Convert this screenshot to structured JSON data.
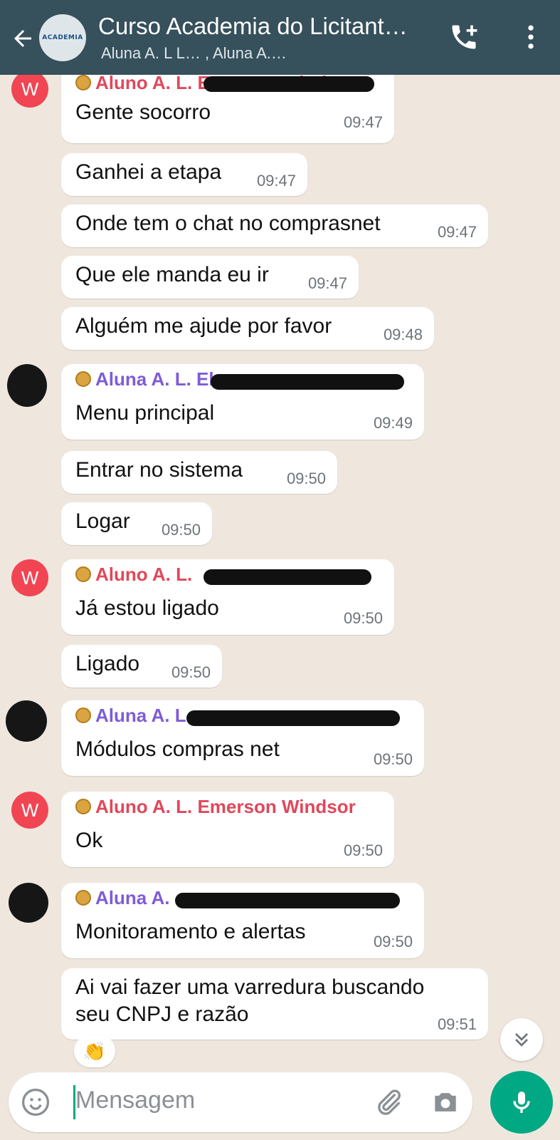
{
  "header": {
    "title": "Curso Academia do Licitant…",
    "subtitle": "Aluna A. L L… , Aluna A.…",
    "avatar_text": "ACADEMIA"
  },
  "messages": [
    {
      "sender": "Aluno A. L. Emerson Windsor",
      "text": "Gente socorro",
      "time": "09:47"
    },
    {
      "text": "Ganhei a etapa",
      "time": "09:47"
    },
    {
      "text": "Onde tem o chat no comprasnet",
      "time": "09:47"
    },
    {
      "text": "Que ele manda eu ir",
      "time": "09:47"
    },
    {
      "text": "Alguém me ajude por favor",
      "time": "09:48"
    },
    {
      "sender": "Aluna A. L. El",
      "text": "Menu principal",
      "time": "09:49"
    },
    {
      "text": "Entrar no sistema",
      "time": "09:50"
    },
    {
      "text": "Logar",
      "time": "09:50"
    },
    {
      "sender": "Aluno A. L.",
      "text": "Já estou ligado",
      "time": "09:50"
    },
    {
      "text": "Ligado",
      "time": "09:50"
    },
    {
      "sender": "Aluna A. L.",
      "text": "Módulos compras net",
      "time": "09:50"
    },
    {
      "sender": "Aluno A. L. Emerson Windsor",
      "text": "Ok",
      "time": "09:50"
    },
    {
      "sender": "Aluna A.",
      "text": "Monitoramento e alertas",
      "time": "09:50"
    },
    {
      "text_line1": "Ai vai fazer uma varredura buscando",
      "text_line2": "seu CNPJ e razão",
      "time": "09:51"
    }
  ],
  "avatar_letter": "W",
  "reaction": "👏",
  "input": {
    "placeholder": "Mensagem"
  },
  "colors": {
    "header_bg": "#36505c",
    "male_sender": "#e0485a",
    "female_sender": "#7e5cd6",
    "accent": "#00a884"
  },
  "icons": [
    "back-arrow-icon",
    "add-call-icon",
    "more-vert-icon",
    "emoji-icon",
    "attach-icon",
    "camera-icon",
    "mic-icon",
    "chevron-down-icon",
    "medal-icon"
  ]
}
